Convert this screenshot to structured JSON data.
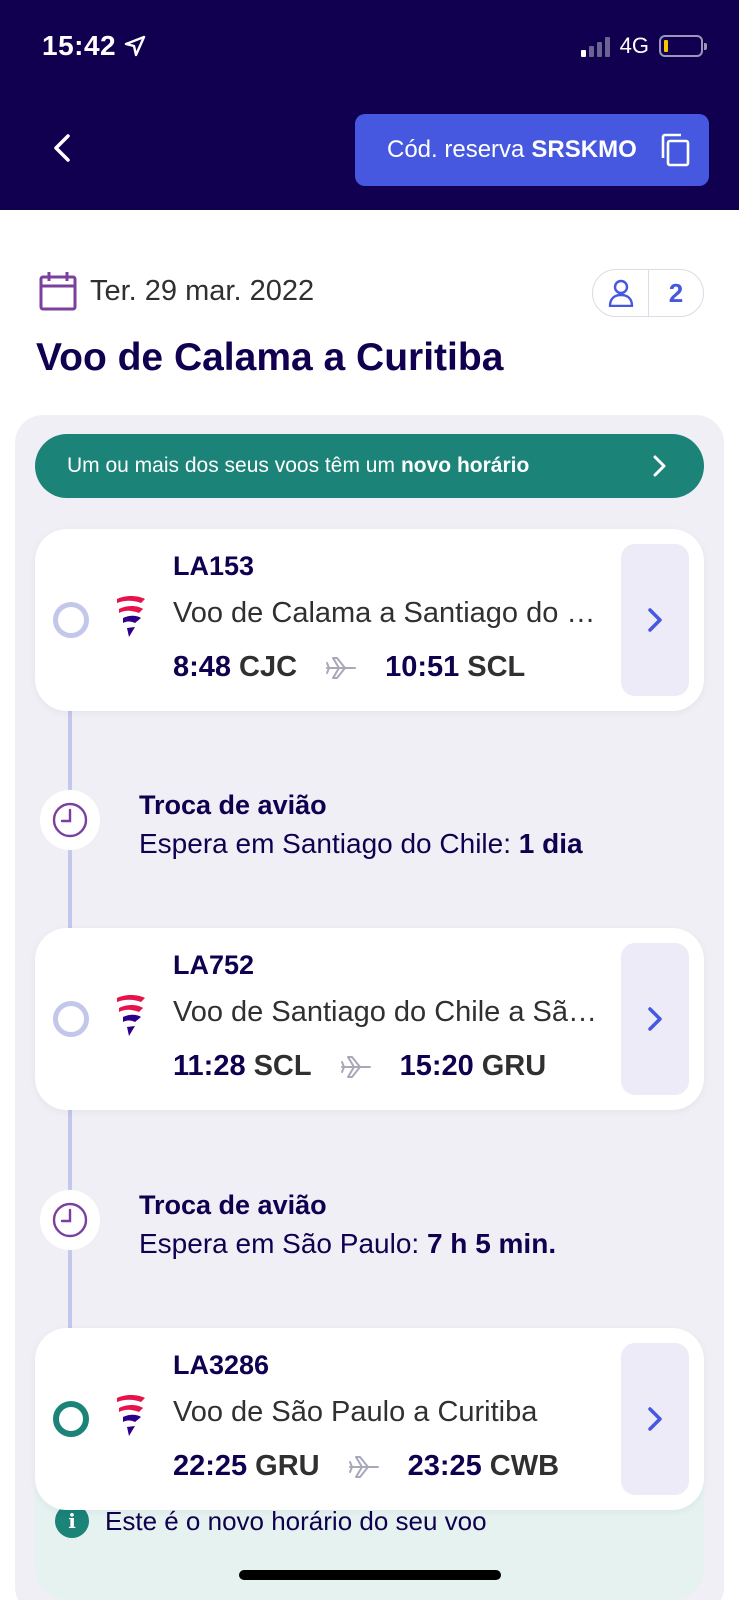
{
  "status_bar": {
    "time": "15:42",
    "network": "4G"
  },
  "header": {
    "reservation_label": "Cód. reserva",
    "reservation_code": "SRSKMO"
  },
  "trip": {
    "date": "Ter. 29 mar. 2022",
    "passengers": "2",
    "title": "Voo de Calama a Curitiba"
  },
  "alert": {
    "text_prefix": "Um ou mais dos seus voos têm um",
    "text_bold": "novo horário"
  },
  "flights": [
    {
      "number": "LA153",
      "route": "Voo de Calama a Santiago do Chile",
      "dep_time": "8:48",
      "dep_airport": "CJC",
      "arr_time": "10:51",
      "arr_airport": "SCL"
    },
    {
      "number": "LA752",
      "route": "Voo de Santiago do Chile a São Paulo",
      "dep_time": "11:28",
      "dep_airport": "SCL",
      "arr_time": "15:20",
      "arr_airport": "GRU"
    },
    {
      "number": "LA3286",
      "route": "Voo de São Paulo a Curitiba",
      "dep_time": "22:25",
      "dep_airport": "GRU",
      "arr_time": "23:25",
      "arr_airport": "CWB"
    }
  ],
  "connections": [
    {
      "title": "Troca de avião",
      "desc_prefix": "Espera em Santiago do Chile:",
      "duration": "1 dia"
    },
    {
      "title": "Troca de avião",
      "desc_prefix": "Espera em São Paulo:",
      "duration": "7 h 5 min."
    }
  ],
  "info": {
    "icon_letter": "i",
    "text": "Este é o novo horário do seu voo"
  },
  "colors": {
    "navy": "#10004f",
    "accent_blue": "#4658df",
    "teal": "#1b8377",
    "timeline": "#c3c7ea"
  }
}
